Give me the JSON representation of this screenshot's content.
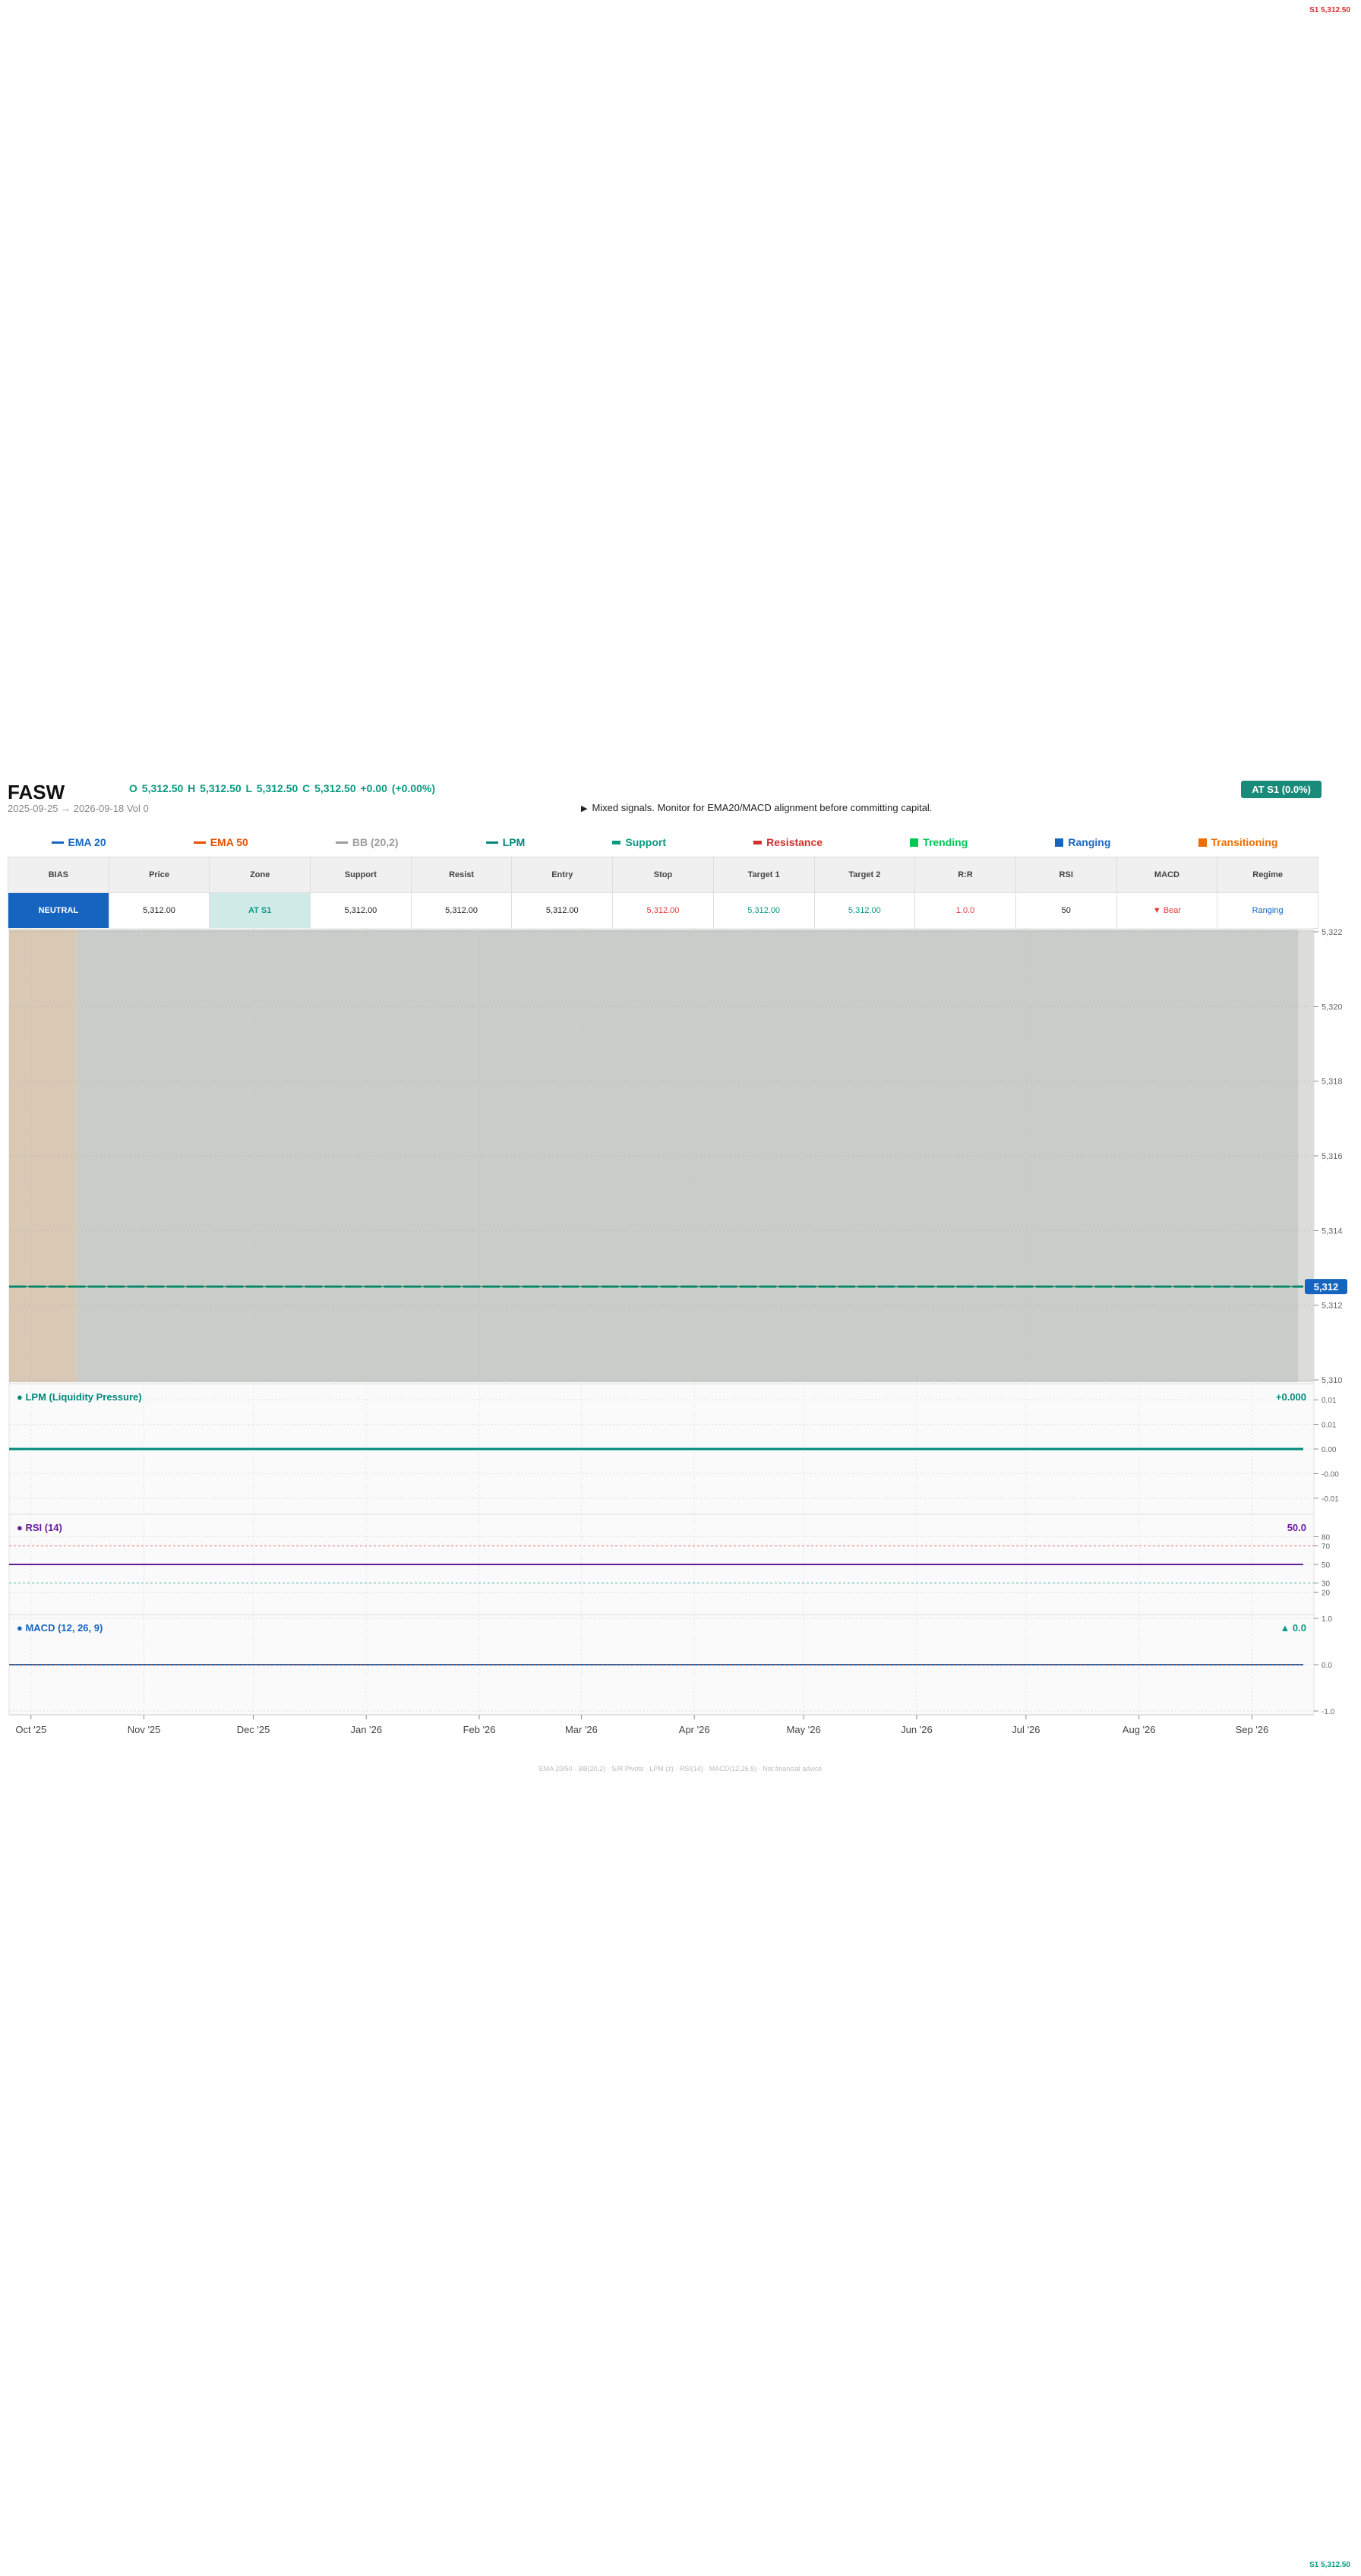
{
  "edge_labels": {
    "top": "S1 5,312.50",
    "bottom": "S1 5,312.50"
  },
  "header": {
    "ticker": "FASW",
    "ohlc": "O 5,312.50   H 5,312.50   L 5,312.50   C 5,312.50   +0.00  (+0.00%)",
    "date_range": "2025-09-25 → 2026-09-18   Vol 0",
    "signal_arrow": "▶",
    "signal": "Mixed signals. Monitor for EMA20/MACD alignment before committing capital.",
    "status_badge": "AT S1  (0.0%)"
  },
  "legend": [
    {
      "label": "EMA 20",
      "color": "#1565c0",
      "kind": "line"
    },
    {
      "label": "EMA 50",
      "color": "#e65100",
      "kind": "line"
    },
    {
      "label": "BB (20,2)",
      "color": "#9e9e9e",
      "kind": "line"
    },
    {
      "label": "LPM",
      "color": "#00897b",
      "kind": "line"
    },
    {
      "label": "Support",
      "color": "#089981",
      "kind": "bar"
    },
    {
      "label": "Resistance",
      "color": "#d32f2f",
      "kind": "bar"
    },
    {
      "label": "Trending",
      "color": "#00c853",
      "kind": "square"
    },
    {
      "label": "Ranging",
      "color": "#1565c0",
      "kind": "square"
    },
    {
      "label": "Transitioning",
      "color": "#ef6c00",
      "kind": "square"
    }
  ],
  "table": {
    "headers": [
      "BIAS",
      "Price",
      "Zone",
      "Support",
      "Resist",
      "Entry",
      "Stop",
      "Target 1",
      "Target 2",
      "R:R",
      "RSI",
      "MACD",
      "Regime"
    ],
    "row": [
      "NEUTRAL",
      "5,312.00",
      "AT S1",
      "5,312.00",
      "5,312.00",
      "5,312.00",
      "5,312.00",
      "5,312.00",
      "5,312.00",
      "1.0.0",
      "50",
      "▼ Bear",
      "Ranging"
    ]
  },
  "footnote": "EMA 20/50  ·  BB(20,2)  ·  S/R Pivots  ·  LPM (z)  ·  RSI(14)  ·  MACD(12,26,9)  ·  Not financial advice",
  "chart_data": {
    "type": "line",
    "price": {
      "series": [
        {
          "values": [
            5312.5,
            5312.5,
            5312.5,
            5312.5,
            5312.5,
            5312.5,
            5312.5,
            5312.5,
            5312.5,
            5312.5,
            5312.5,
            5312.5
          ]
        }
      ],
      "ylim": [
        5310,
        5322
      ],
      "y_ticks": [
        "5,310",
        "5,312",
        "5,314",
        "5,316",
        "5,318",
        "5,320",
        "5,322"
      ],
      "y_tick_values": [
        5310,
        5312,
        5314,
        5316,
        5318,
        5320,
        5322
      ],
      "last_price_tag": "5,312",
      "last_price": 5312.5,
      "regime_bands": [
        {
          "regime": "Transitioning",
          "color": "#d8c8b4",
          "from_frac": 0.0,
          "to_frac": 0.052
        },
        {
          "regime": "Ranging",
          "color": "#c8cdc9",
          "from_frac": 0.052,
          "to_frac": 0.988
        },
        {
          "regime": "Neutral",
          "color": "#dcdcd8",
          "from_frac": 0.988,
          "to_frac": 1.0
        }
      ],
      "support_level": 5312.5
    },
    "x_ticks": [
      "Oct '25",
      "Nov '25",
      "Dec '25",
      "Jan '26",
      "Feb '26",
      "Mar '26",
      "Apr '26",
      "May '26",
      "Jun '26",
      "Jul '26",
      "Aug '26",
      "Sep '26"
    ],
    "x_tick_dates": [
      "2025-10-01",
      "2025-11-01",
      "2025-12-01",
      "2026-01-01",
      "2026-02-01",
      "2026-03-01",
      "2026-04-01",
      "2026-05-01",
      "2026-06-01",
      "2026-07-01",
      "2026-08-01",
      "2026-09-01"
    ],
    "x_range": [
      "2025-09-25",
      "2026-09-18"
    ],
    "lpm": {
      "title": "● LPM (Liquidity Pressure)",
      "value_label": "+0.000",
      "value": 0.0,
      "ylim": [
        -0.015,
        0.015
      ],
      "y_ticks": [
        "0.01",
        "0.01",
        "0.00",
        "-0.00",
        "-0.01"
      ],
      "y_tick_values": [
        0.012,
        0.006,
        0.0,
        -0.006,
        -0.012
      ],
      "color": "#00897b"
    },
    "rsi": {
      "title": "● RSI (14)",
      "value_label": "50.0",
      "value": 50.0,
      "ylim": [
        0,
        100
      ],
      "y_ticks": [
        "80",
        "70",
        "50",
        "30",
        "20"
      ],
      "y_tick_values": [
        80,
        70,
        50,
        30,
        20
      ],
      "color": "#6a1b9a"
    },
    "macd": {
      "title": "● MACD (12, 26, 9)",
      "value_label": "▲ 0.0",
      "value": 0.0,
      "ylim": [
        -1.0,
        1.0
      ],
      "y_ticks": [
        "1.0",
        "0.0",
        "-1.0"
      ],
      "y_tick_values": [
        1.0,
        0.0,
        -1.0
      ],
      "color": "#1565c0"
    }
  }
}
